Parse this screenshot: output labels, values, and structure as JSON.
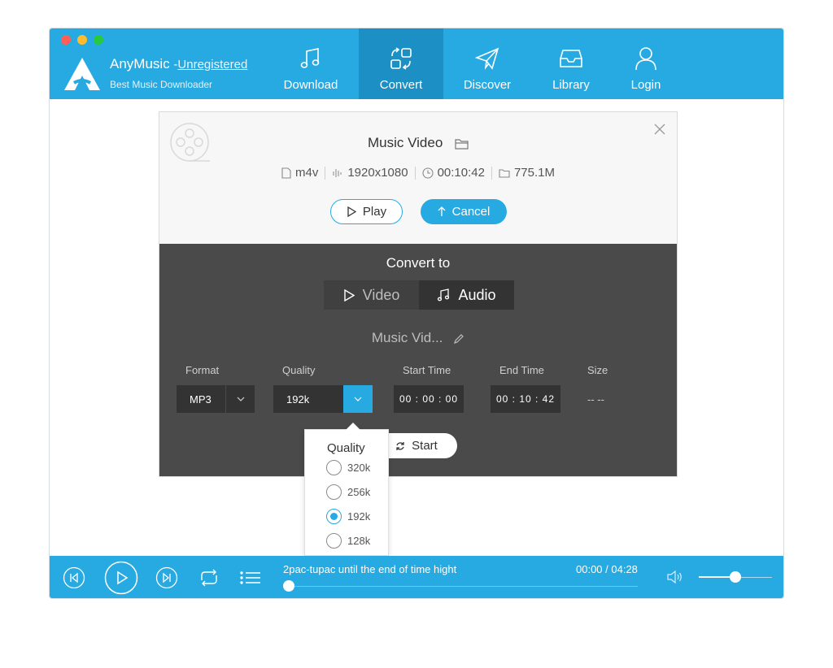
{
  "app": {
    "name": "AnyMusic",
    "registration_prefix": "-",
    "registration_status": "Unregistered",
    "subtitle": "Best Music Downloader"
  },
  "nav": {
    "download": "Download",
    "convert": "Convert",
    "discover": "Discover",
    "library": "Library",
    "login": "Login",
    "active": "convert"
  },
  "video": {
    "title": "Music Video",
    "format": "m4v",
    "resolution": "1920x1080",
    "duration": "00:10:42",
    "file_size": "775.1M",
    "play_label": "Play",
    "cancel_label": "Cancel"
  },
  "convert": {
    "title": "Convert to",
    "video_label": "Video",
    "audio_label": "Audio",
    "selected_type": "Audio",
    "filename": "Music Vid...",
    "labels": {
      "format": "Format",
      "quality": "Quality",
      "start_time": "Start Time",
      "end_time": "End Time",
      "size": "Size"
    },
    "format_value": "MP3",
    "quality_value": "192k",
    "start_time_value": "00 : 00 : 00",
    "end_time_value": "00 : 10 : 42",
    "size_value": "-- --",
    "start_label": "Start"
  },
  "quality_dropdown": {
    "title": "Quality",
    "options": [
      "320k",
      "256k",
      "192k",
      "128k"
    ],
    "selected": "192k"
  },
  "player": {
    "track": "2pac-tupac until the end of time hight",
    "time": "00:00 / 04:28",
    "progress": 0,
    "volume": 0.5
  },
  "colors": {
    "accent": "#27a9e1",
    "panel_dark": "#4a4a4a",
    "field_dark": "#333333"
  }
}
